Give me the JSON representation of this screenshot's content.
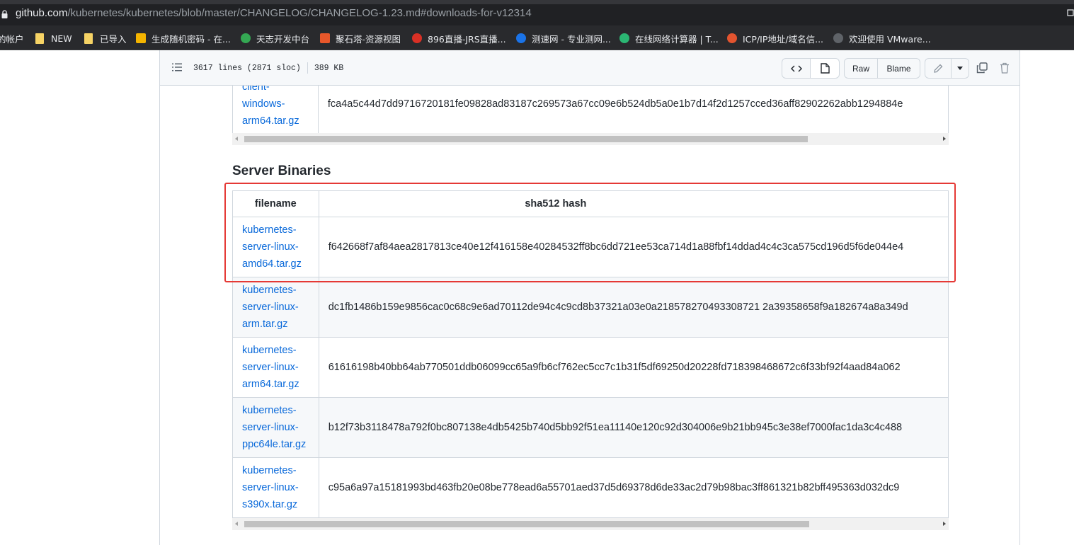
{
  "browser": {
    "url_host": "github.com",
    "url_path": "/kubernetes/kubernetes/blob/master/CHANGELOG/CHANGELOG-1.23.md#downloads-for-v12314",
    "bookmarks": [
      {
        "label": "的帐户",
        "icon": "account-icon"
      },
      {
        "label": "NEW",
        "icon": "folder-icon"
      },
      {
        "label": "已导入",
        "icon": "folder-icon"
      },
      {
        "label": "生成随机密码 - 在...",
        "icon": "password-site-icon"
      },
      {
        "label": "天志开发中台",
        "icon": "dev-platform-icon"
      },
      {
        "label": "聚石塔-资源视图",
        "icon": "jushita-icon"
      },
      {
        "label": "896直播-JRS直播...",
        "icon": "live-icon"
      },
      {
        "label": "测速网 - 专业测网...",
        "icon": "speedtest-icon"
      },
      {
        "label": "在线网络计算器 | T...",
        "icon": "calculator-icon"
      },
      {
        "label": "ICP/IP地址/域名信...",
        "icon": "icp-icon"
      },
      {
        "label": "欢迎使用 VMware...",
        "icon": "vmware-icon"
      }
    ]
  },
  "file_header": {
    "lines": "3617 lines (2871 sloc)",
    "size": "389 KB",
    "raw_label": "Raw",
    "blame_label": "Blame"
  },
  "prev_table": {
    "last_row": {
      "filename_lines": [
        "client-",
        "windows-",
        "arm64.tar.gz"
      ],
      "hash": "fca4a5c44d7dd9716720181fe09828ad83187c269573a67cc09e6b524db5a0e1b7d14f2d1257cced36aff82902262abb1294884e"
    }
  },
  "server_binaries": {
    "heading": "Server Binaries",
    "col_filename": "filename",
    "col_hash": "sha512 hash",
    "rows": [
      {
        "filename_lines": [
          "kubernetes-",
          "server-linux-",
          "amd64.tar.gz"
        ],
        "hash": "f642668f7af84aea2817813ce40e12f416158e40284532ff8bc6dd721ee53ca714d1a88fbf14ddad4c4c3ca575cd196d5f6de044e4"
      },
      {
        "filename_lines": [
          "kubernetes-",
          "server-linux-",
          "arm.tar.gz"
        ],
        "hash": "dc1fb1486b159e9856cac0c68c9e6ad70112de94c4c9cd8b37321a03e0a218578270493308721 2a39358658f9a182674a8a349d"
      },
      {
        "filename_lines": [
          "kubernetes-",
          "server-linux-",
          "arm64.tar.gz"
        ],
        "hash": "61616198b40bb64ab770501ddb06099cc65a9fb6cf762ec5cc7c1b31f5df69250d20228fd718398468672c6f33bf92f4aad84a062"
      },
      {
        "filename_lines": [
          "kubernetes-",
          "server-linux-",
          "ppc64le.tar.gz"
        ],
        "hash": "b12f73b3118478a792f0bc807138e4db5425b740d5bb92f51ea11140e120c92d304006e9b21bb945c3e38ef7000fac1da3c4c488"
      },
      {
        "filename_lines": [
          "kubernetes-",
          "server-linux-",
          "s390x.tar.gz"
        ],
        "hash": "c95a6a97a15181993bd463fb20e08be778ead6a55701aed37d5d69378d6de33ac2d79b98bac3ff861321b82bff495363d032dc9"
      }
    ]
  },
  "highlight_color": "#e53935",
  "link_color": "#0969da"
}
